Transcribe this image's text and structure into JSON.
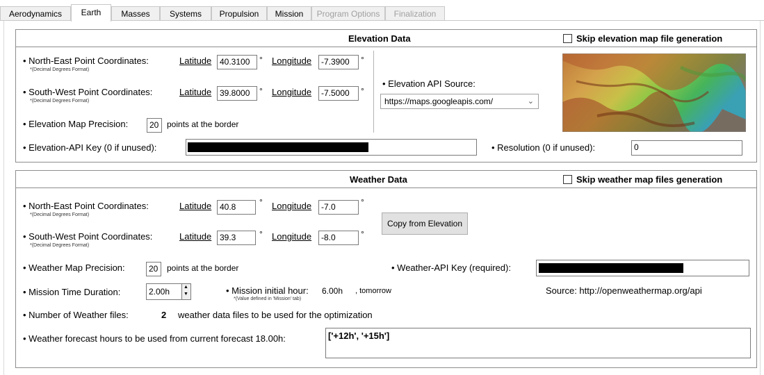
{
  "tabs": [
    {
      "label": "Aerodynamics"
    },
    {
      "label": "Earth"
    },
    {
      "label": "Masses"
    },
    {
      "label": "Systems"
    },
    {
      "label": "Propulsion"
    },
    {
      "label": "Mission"
    },
    {
      "label": "Program Options"
    },
    {
      "label": "Finalization"
    }
  ],
  "elevation": {
    "title": "Elevation Data",
    "skip_label": "Skip elevation map file generation",
    "ne_label": "• North-East Point Coordinates:",
    "sw_label": "• South-West Point Coordinates:",
    "format_note": "*(Decimal Degrees Format)",
    "lat_label": "Latitude",
    "lon_label": "Longitude",
    "deg": "°",
    "ne_lat": "40.3100",
    "ne_lon": "-7.3900",
    "sw_lat": "39.8000",
    "sw_lon": "-7.5000",
    "precision_label": "• Elevation Map Precision:",
    "precision_value": "20",
    "precision_unit": "points at the border",
    "api_source_label": "• Elevation API Source:",
    "api_source_value": "https://maps.googleapis.com/",
    "api_key_label": "• Elevation-API Key (0 if unused):",
    "resolution_label": "• Resolution (0 if unused):",
    "resolution_value": "0"
  },
  "weather": {
    "title": "Weather Data",
    "skip_label": "Skip weather map files generation",
    "ne_label": "• North-East Point Coordinates:",
    "sw_label": "• South-West Point Coordinates:",
    "format_note": "*(Decimal Degrees Format)",
    "lat_label": "Latitude",
    "lon_label": "Longitude",
    "deg": "°",
    "ne_lat": "40.8",
    "ne_lon": "-7.0",
    "sw_lat": "39.3",
    "sw_lon": "-8.0",
    "copy_button": "Copy from Elevation",
    "precision_label": "• Weather Map Precision:",
    "precision_value": "20",
    "precision_unit": "points at the border",
    "api_key_label": "• Weather-API Key (required):",
    "duration_label": "• Mission Time Duration:",
    "duration_value": "2.00h",
    "initial_hour_label": "• Mission initial hour:",
    "initial_hour_value": "6.00h",
    "initial_hour_suffix": ", tomorrow",
    "initial_hour_note": "*(Value defined in 'Mission' tab)",
    "source_label": "Source: http://openweathermap.org/api",
    "files_label": "• Number of Weather files:",
    "files_value": "2",
    "files_suffix": "weather data files to be used for the optimization",
    "forecast_label": "• Weather forecast hours to be used from current forecast 18.00h:",
    "forecast_value": "['+12h', '+15h']"
  },
  "colors": {
    "border": "#8c8c8c",
    "redaction": "#000000"
  }
}
